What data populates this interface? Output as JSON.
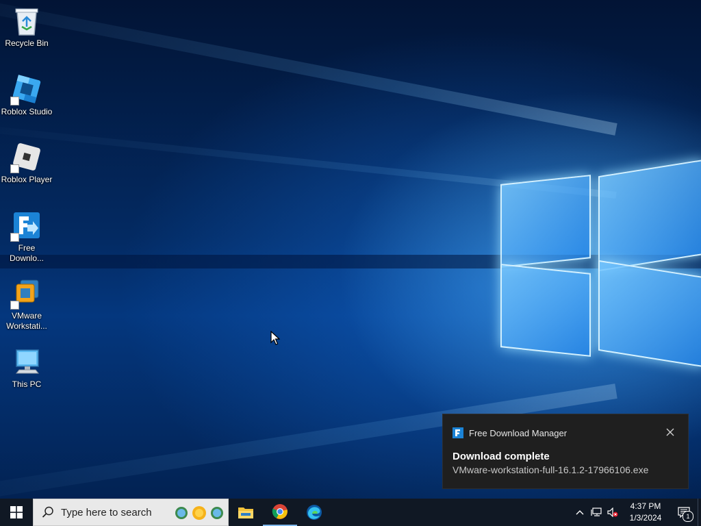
{
  "desktop": {
    "icons": [
      {
        "label": "Recycle Bin",
        "icon": "recycle-bin-icon"
      },
      {
        "label": "Roblox Studio",
        "icon": "roblox-studio-icon"
      },
      {
        "label": "Roblox Player",
        "icon": "roblox-player-icon"
      },
      {
        "label": "Free Downlo...",
        "icon": "free-download-manager-icon"
      },
      {
        "label": "VMware Workstati...",
        "icon": "vmware-workstation-icon"
      },
      {
        "label": "This PC",
        "icon": "this-pc-icon"
      }
    ]
  },
  "notification": {
    "app_name": "Free Download Manager",
    "title": "Download complete",
    "body": "VMware-workstation-full-16.1.2-17966106.exe"
  },
  "taskbar": {
    "search_placeholder": "Type here to search",
    "pinned": [
      "file-explorer-icon",
      "chrome-icon",
      "edge-icon"
    ],
    "clock_time": "4:37 PM",
    "clock_date": "1/3/2024",
    "notification_count": "1"
  },
  "colors": {
    "accent": "#0078d7",
    "taskbar_bg": "#101824",
    "toast_bg": "#1f1f1f"
  }
}
